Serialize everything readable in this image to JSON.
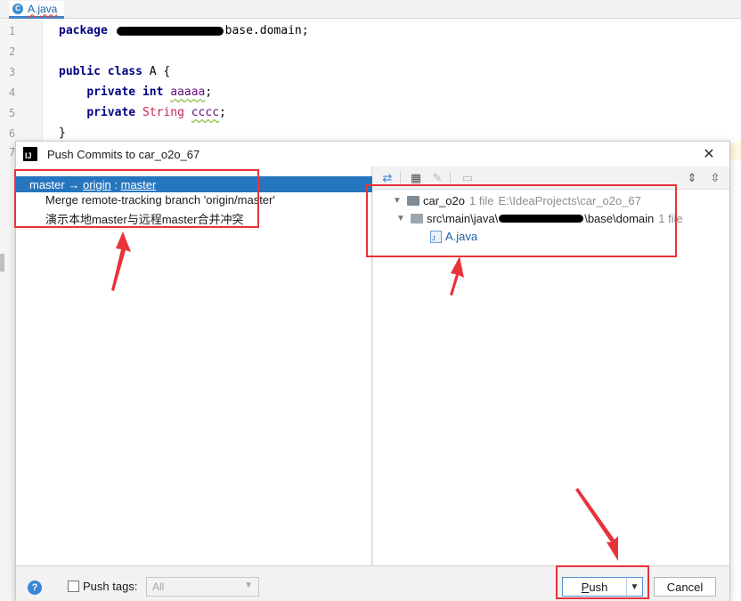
{
  "editor": {
    "tab_label": "A.java",
    "tab_icon_letter": "C",
    "line_numbers": [
      "1",
      "2",
      "3",
      "4",
      "5",
      "6",
      "7"
    ],
    "line1": {
      "kw": "package",
      "after": "base.domain;"
    },
    "line3": {
      "kw1": "public",
      "kw2": "class",
      "rest": " A {"
    },
    "line4": {
      "kw1": "private",
      "kw2": "int",
      "field": "aaaaa",
      "end": ";"
    },
    "line5": {
      "kw": "private",
      "type": "String",
      "field": "cccc",
      "end": ";"
    },
    "line6": "}"
  },
  "dialog": {
    "title": "Push Commits to car_o2o_67",
    "app_icon": "IJ",
    "close_glyph": "✕",
    "branch": {
      "local": "master",
      "arrow": " → ",
      "remote": "origin",
      "sep": " : ",
      "remote_branch": "master"
    },
    "commits": [
      "Merge remote-tracking branch 'origin/master'",
      "演示本地master与远程master合并冲突"
    ],
    "tree": {
      "root_name": "car_o2o",
      "root_count": "1 file",
      "root_path": "E:\\IdeaProjects\\car_o2o_67",
      "pkg_prefix": "src\\main\\java\\",
      "pkg_suffix": "\\base\\domain",
      "pkg_count": "1 file",
      "file": "A.java"
    },
    "push_tags_label": "Push tags:",
    "push_tags_select": "All",
    "push_button": "Push",
    "cancel_button": "Cancel",
    "help_glyph": "?"
  },
  "colors": {
    "selection": "#2675bf",
    "annotation": "#e8333b",
    "link": "#1f5fa6"
  }
}
